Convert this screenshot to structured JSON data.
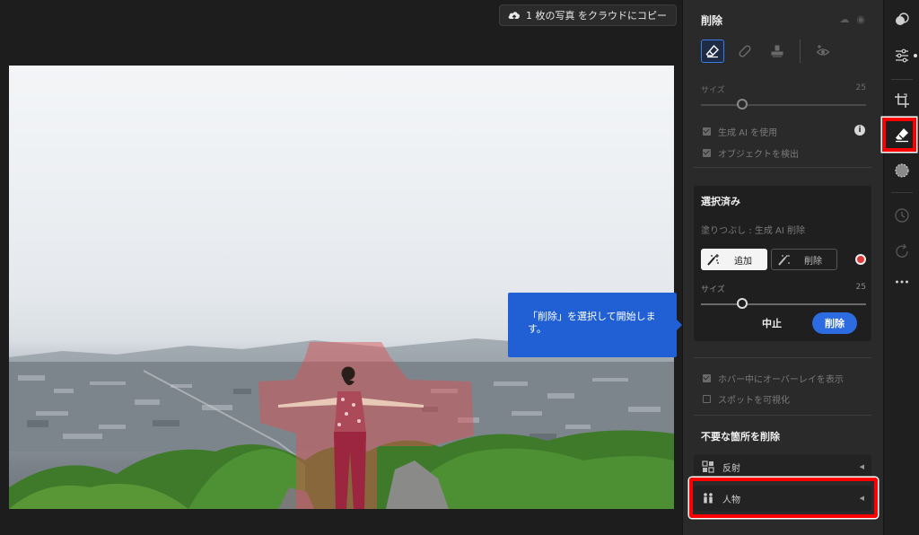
{
  "canvas": {
    "cloud_copy_label": "1 枚の写真 をクラウドにコピー",
    "tooltip_text": "「削除」を選択して開始します。"
  },
  "panel": {
    "title": "削除",
    "size_slider": {
      "label": "サイズ",
      "value": "25",
      "fraction": 0.25
    },
    "options": [
      {
        "label": "生成 AI を使用",
        "checked": true
      },
      {
        "label": "オブジェクトを検出",
        "checked": true
      }
    ],
    "selected": {
      "title": "選択済み",
      "fill_label": "塗りつぶし : 生成 AI 削除",
      "add_label": "追加",
      "subtract_label": "削除",
      "size_slider": {
        "label": "サイズ",
        "value": "25",
        "fraction": 0.25
      },
      "cancel_label": "中止",
      "delete_label": "削除"
    },
    "overlay_options": [
      {
        "label": "ホバー中にオーバーレイを表示",
        "checked": true
      },
      {
        "label": "スポットを可視化",
        "checked": false
      }
    ],
    "section_title": "不要な箇所を削除",
    "list_items": [
      {
        "label": "反射"
      },
      {
        "label": "人物"
      }
    ]
  },
  "colors": {
    "accent": "#2c6be0",
    "tooltip": "#2060d4",
    "highlight": "#ff0000",
    "mask": "#e05050"
  }
}
